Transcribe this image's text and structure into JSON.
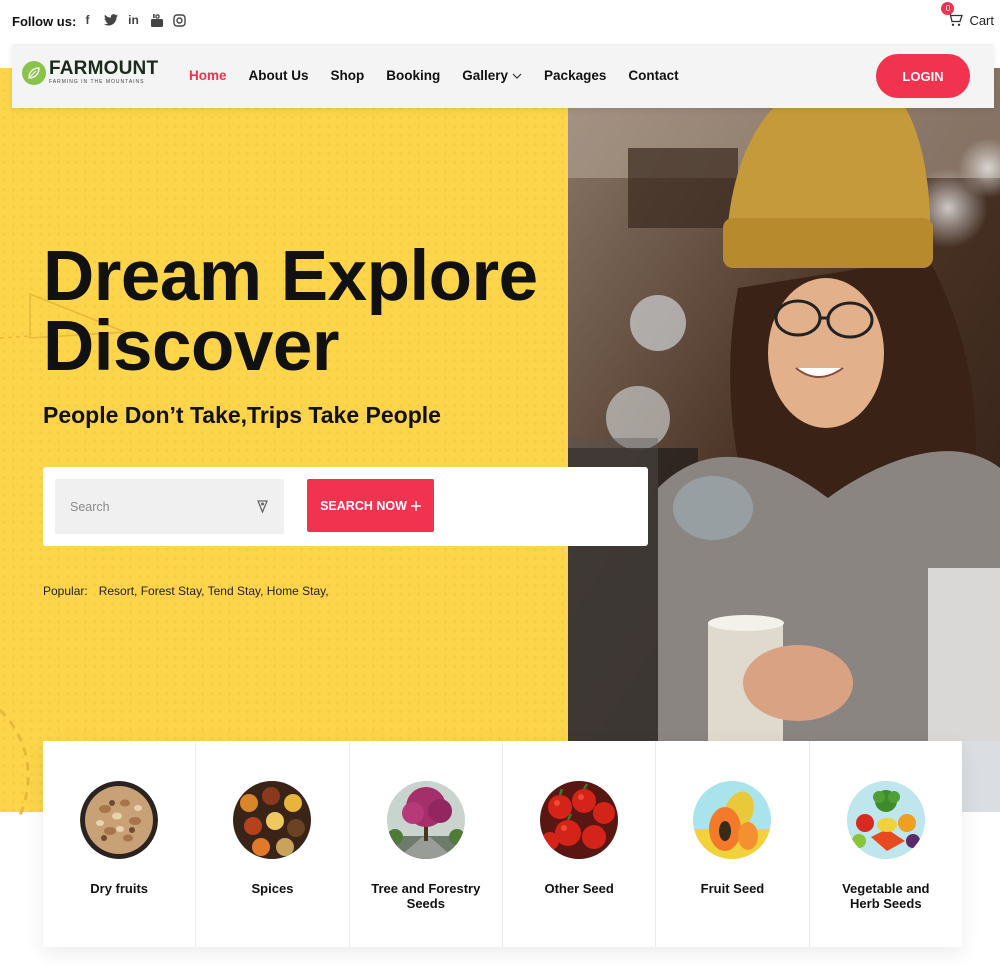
{
  "topbar": {
    "follow_label": "Follow us:",
    "social": [
      "facebook-icon",
      "twitter-icon",
      "linkedin-icon",
      "youtube-icon",
      "instagram-icon"
    ],
    "cart_label": "Cart",
    "cart_count": "0"
  },
  "brand": {
    "name": "FARMOUNT",
    "tagline": "FARMING IN THE MOUNTAINS",
    "color": "#8bc34a"
  },
  "nav": {
    "items": [
      {
        "label": "Home",
        "active": true
      },
      {
        "label": "About Us"
      },
      {
        "label": "Shop"
      },
      {
        "label": "Booking"
      },
      {
        "label": "Gallery",
        "dropdown": true
      },
      {
        "label": "Packages"
      },
      {
        "label": "Contact"
      }
    ],
    "login_label": "LOGIN"
  },
  "hero": {
    "line1": "Dream Explore",
    "line2": "Discover",
    "tagline": "People Don’t Take,Trips Take People",
    "search_placeholder": "Search",
    "search_button": "SEARCH NOW",
    "popular_label": "Popular:",
    "popular_items": "Resort, Forest Stay, Tend Stay, Home Stay,"
  },
  "categories": [
    {
      "name": "Dry fruits"
    },
    {
      "name": "Spices"
    },
    {
      "name": "Tree and Forestry Seeds"
    },
    {
      "name": "Other Seed"
    },
    {
      "name": "Fruit Seed"
    },
    {
      "name": "Vegetable and Herb Seeds"
    }
  ],
  "colors": {
    "accent": "#f2334f",
    "hero_yellow": "#fdd54b"
  }
}
